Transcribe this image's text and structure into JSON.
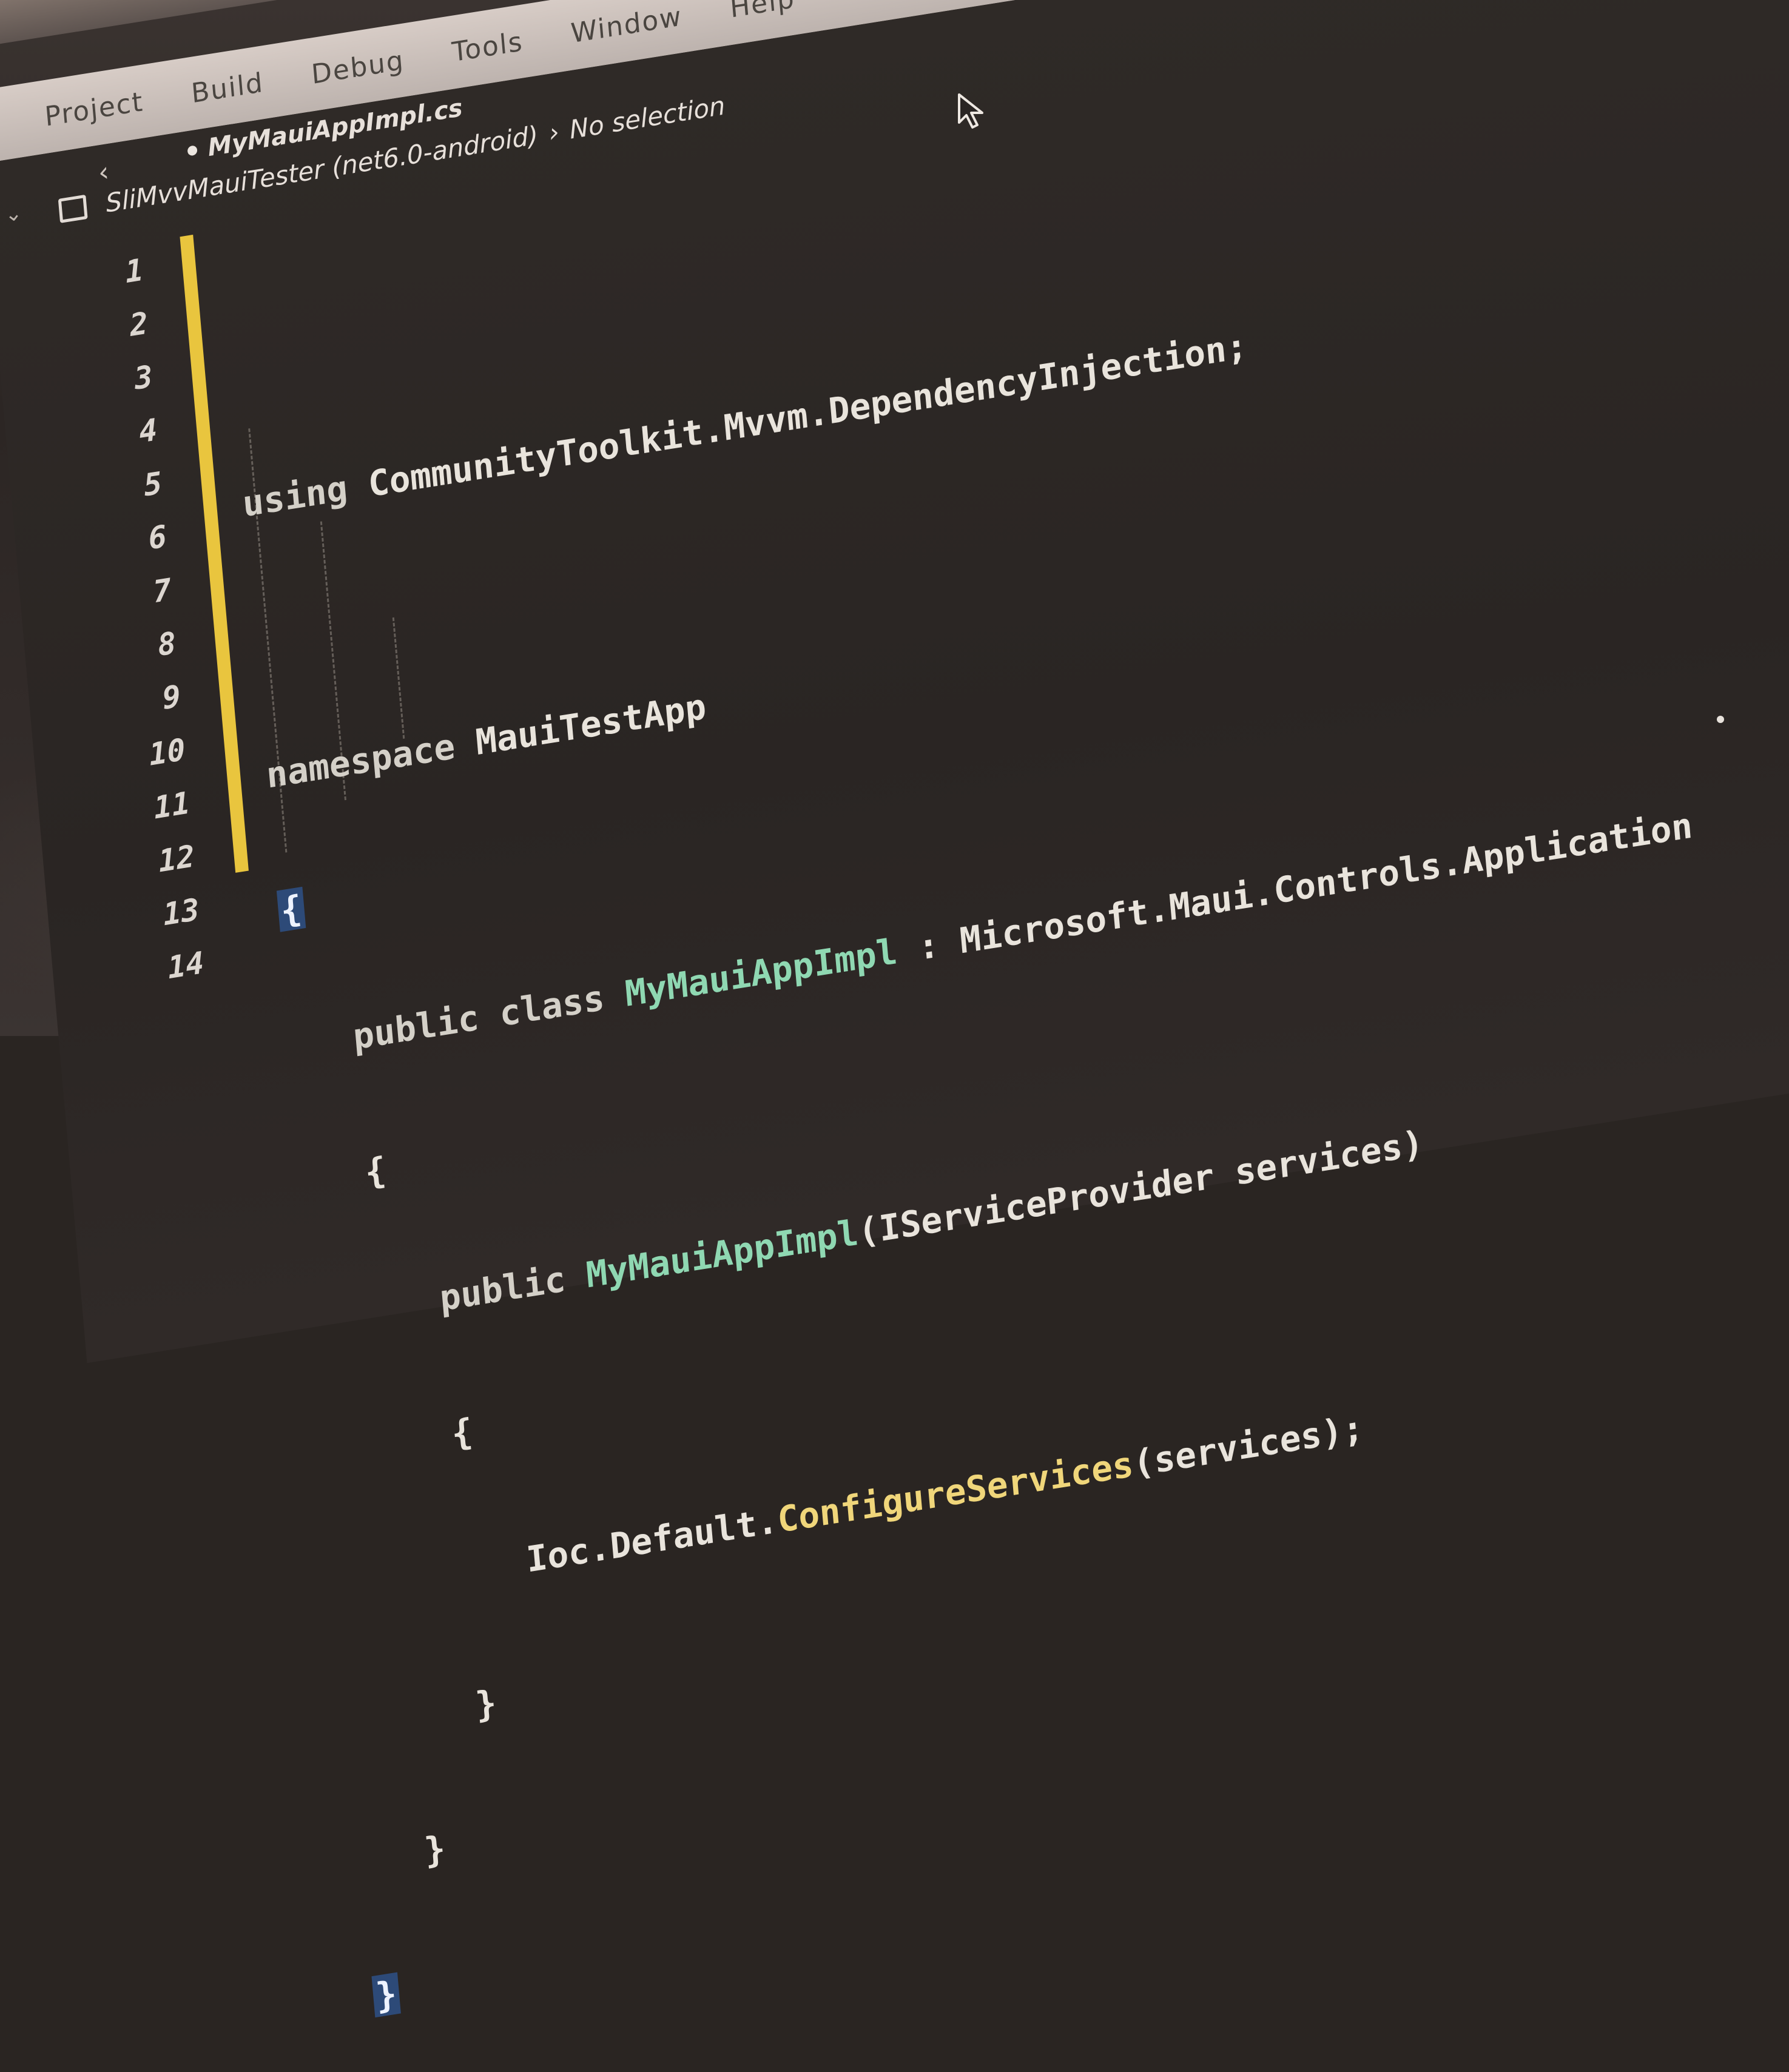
{
  "menu": {
    "items": [
      "Project",
      "Build",
      "Debug",
      "Tools",
      "Window",
      "Help"
    ]
  },
  "editor": {
    "open_file": "MyMauiAppImpl.cs",
    "breadcrumb": {
      "project": "SliMvvMauiTester (net6.0-android)",
      "separator": "›",
      "selection": "No selection"
    },
    "line_numbers": [
      "1",
      "2",
      "3",
      "4",
      "5",
      "6",
      "7",
      "8",
      "9",
      "10",
      "11",
      "12",
      "13",
      "14"
    ],
    "lines": [
      {
        "kw": "using ",
        "rest": "CommunityToolkit.Mvvm.DependencyInjection;"
      },
      {
        "kw": "",
        "rest": ""
      },
      {
        "kw": "namespace ",
        "rest": "MauiTestApp"
      },
      {
        "brace": "{"
      },
      {
        "kw": "public class ",
        "type": "MyMauiAppImpl",
        "rest": " : Microsoft.Maui.Controls.Application"
      },
      {
        "rest": "{"
      },
      {
        "kw": "public ",
        "type": "MyMauiAppImpl",
        "rest": "(IServiceProvider services)"
      },
      {
        "rest": "{"
      },
      {
        "kw": "Ioc.Default.",
        "method": "ConfigureServices",
        "rest": "(services);"
      },
      {
        "rest": "}"
      },
      {
        "rest": "}"
      },
      {
        "brace": "}"
      }
    ]
  },
  "icons": {
    "cursor": "mouse-pointer-icon",
    "back": "chevron-left-icon",
    "project": "project-box-icon"
  },
  "colors": {
    "change_bar": "#e9c53e",
    "type_name": "#8fd8b2",
    "method_name": "#f0d67a",
    "brace_highlight": "#2d4a78"
  }
}
